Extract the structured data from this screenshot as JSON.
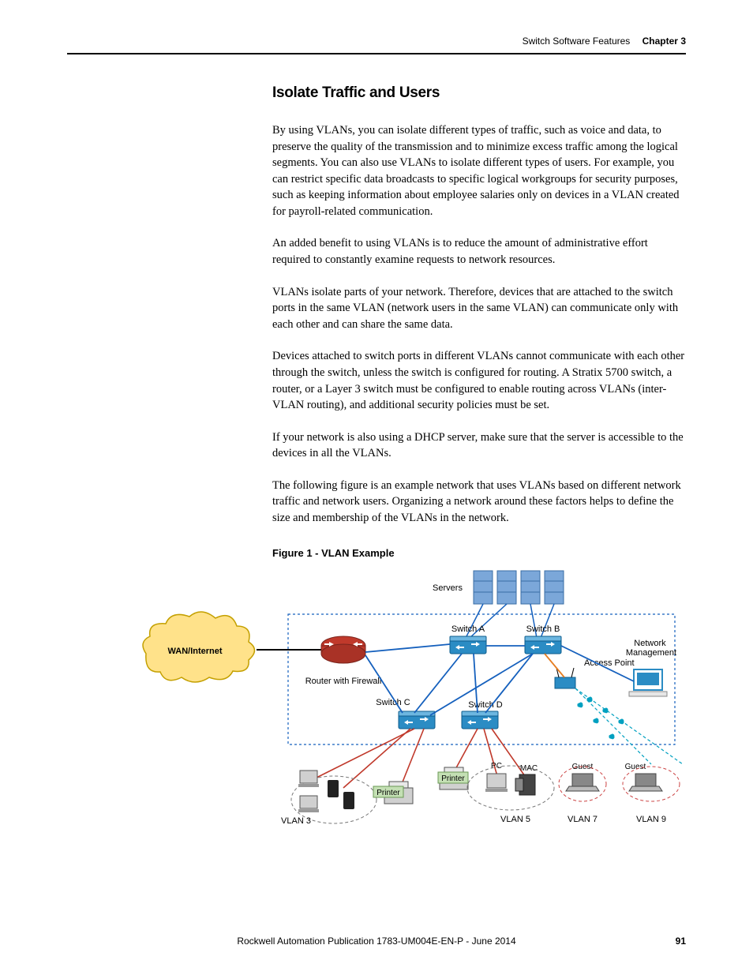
{
  "header": {
    "section": "Switch Software Features",
    "chapter": "Chapter 3"
  },
  "heading": "Isolate Traffic and Users",
  "paragraphs": {
    "p1": "By using VLANs, you can isolate different types of traffic, such as voice and data, to preserve the quality of the transmission and to minimize excess traffic among the logical segments. You can also use VLANs to isolate different types of users. For example, you can restrict specific data broadcasts to specific logical workgroups for security purposes, such as keeping information about employee salaries only on devices in a VLAN created for payroll-related communication.",
    "p2": "An added benefit to using VLANs is to reduce the amount of administrative effort required to constantly examine requests to network resources.",
    "p3": "VLANs isolate parts of your network. Therefore, devices that are attached to the switch ports in the same VLAN (network users in the same VLAN) can communicate only with each other and can share the same data.",
    "p4": "Devices attached to switch ports in different VLANs cannot communicate with each other through the switch, unless the switch is configured for routing. A Stratix 5700 switch, a router, or a Layer 3 switch must be configured to enable routing across VLANs (inter-VLAN routing), and additional security policies must be set.",
    "p5": "If your network is also using a DHCP server, make sure that the server is accessible to the devices in all the VLANs.",
    "p6": "The following figure is an example network that uses VLANs based on different network traffic and network users. Organizing a network around these factors helps to define the size and membership of the VLANs in the network."
  },
  "figure": {
    "caption": "Figure 1 - VLAN Example",
    "labels": {
      "servers": "Servers",
      "switchA": "Switch A",
      "switchB": "Switch B",
      "switchC": "Switch C",
      "switchD": "Switch D",
      "wan": "WAN/Internet",
      "router": "Router with Firewall",
      "network_mgmt": "Network Management",
      "access_point": "Access Point",
      "pc": "PC",
      "mac": "MAC",
      "guest1": "Guest",
      "guest2": "Guest",
      "printer1": "Printer",
      "printer2": "Printer",
      "vlan3": "VLAN 3",
      "vlan5": "VLAN 5",
      "vlan7": "VLAN 7",
      "vlan9": "VLAN 9"
    }
  },
  "footer": {
    "publication": "Rockwell Automation Publication 1783-UM004E-EN-P - June 2014",
    "page": "91"
  }
}
